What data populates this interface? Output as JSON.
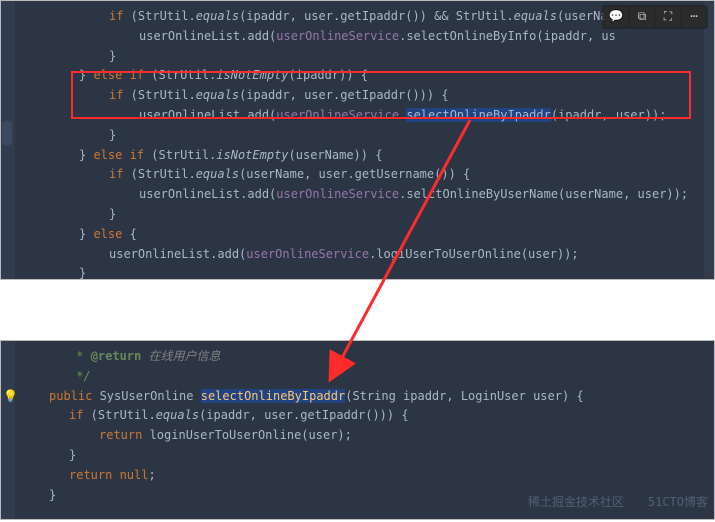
{
  "toolbar": {
    "comment": "comment",
    "copy": "copy",
    "fullscreen": "fullscreen",
    "more": "more"
  },
  "top": {
    "l1a": "if",
    "l1b": " (StrUtil.",
    "l1c": "equals",
    "l1d": "(ipaddr, user.getIpaddr()) && StrUtil.",
    "l1e": "equals",
    "l1f": "(userNa",
    "l2a": "userOnlineList.add(",
    "l2b": "userOnlineService",
    "l2c": ".selectOnlineByInfo(ipaddr, us",
    "l3": "}",
    "l4a": "} ",
    "l4b": "else if",
    "l4c": " (StrUtil.",
    "l4d": "isNotEmpty",
    "l4e": "(ipaddr)) {",
    "l5a": "if",
    "l5b": " (StrUtil.",
    "l5c": "equals",
    "l5d": "(ipaddr, user.getIpaddr())) {",
    "l6a": "userOnlineList.add(",
    "l6b": "userOnlineService",
    "l6c": ".",
    "l6d": "selectOnlineByIpaddr",
    "l6e": "(ipaddr, user));",
    "l7": "}",
    "l8a": "} ",
    "l8b": "else if",
    "l8c": " (StrUtil.",
    "l8d": "isNotEmpty",
    "l8e": "(userName)) {",
    "l9a": "if",
    "l9b": " (StrUtil.",
    "l9c": "equals",
    "l9d": "(userName, user.getUsername(",
    "l9e": ")) {",
    "l10a": "userOnlineList.add(",
    "l10b": "userOnlineService",
    "l10c": ".sel",
    "l10d": "ctOnlineByUserName(userName, user));",
    "l11": "}",
    "l12a": "} ",
    "l12b": "else",
    "l12c": " {",
    "l13a": "userOnlineList.add(",
    "l13b": "userOnlineService",
    "l13c": ".logi",
    "l13d": "UserToUserOnline(user));",
    "l14": "}"
  },
  "bottom": {
    "l1a": " * ",
    "l1b": "@return",
    "l1c": " 在线用户信息",
    "l2": " */",
    "l3a": "public",
    "l3b": " SysUserOnline ",
    "l3c": "selectOnlineByIpaddr",
    "l3d": "(String ipaddr, LoginUser user) {",
    "l4a": "if",
    "l4b": " (StrUtil.",
    "l4c": "equals",
    "l4d": "(ipaddr, user.getIpaddr())) {",
    "l5a": "return",
    "l5b": " loginUserToUserOnline(user);",
    "l6": "}",
    "l7a": "return null",
    "l7b": ";",
    "l8": "}"
  },
  "watermarks": {
    "w1": "稀土掘金技术社区",
    "w2": "51CTO博客"
  }
}
